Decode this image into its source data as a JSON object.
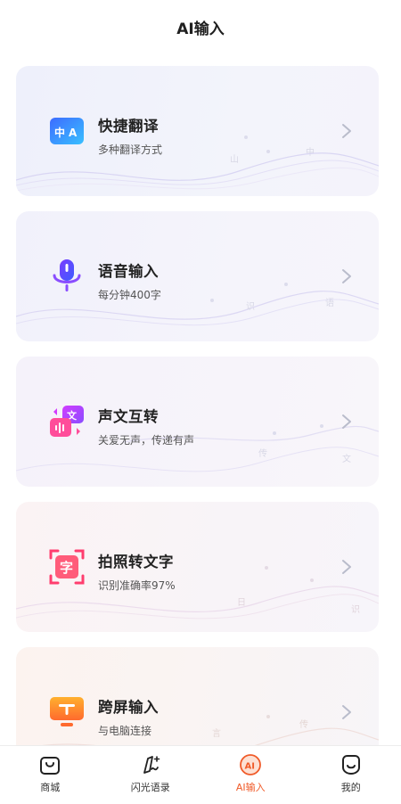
{
  "header": {
    "title": "AI输入"
  },
  "features": [
    {
      "title": "快捷翻译",
      "subtitle": "多种翻译方式",
      "icon": "translate-icon"
    },
    {
      "title": "语音输入",
      "subtitle": "每分钟400字",
      "icon": "microphone-icon"
    },
    {
      "title": "声文互转",
      "subtitle": "关爱无声，传递有声",
      "icon": "voice-text-convert-icon"
    },
    {
      "title": "拍照转文字",
      "subtitle": "识别准确率97%",
      "icon": "photo-ocr-icon"
    },
    {
      "title": "跨屏输入",
      "subtitle": "与电脑连接",
      "icon": "cross-screen-icon"
    }
  ],
  "tabs": [
    {
      "label": "商城",
      "icon": "shop-bag-icon",
      "active": false
    },
    {
      "label": "闪光语录",
      "icon": "quote-pen-icon",
      "active": false
    },
    {
      "label": "AI输入",
      "icon": "ai-icon",
      "active": true
    },
    {
      "label": "我的",
      "icon": "profile-smile-icon",
      "active": false
    }
  ],
  "colors": {
    "accent": "#f05a28",
    "chevron": "#b9bccb"
  }
}
